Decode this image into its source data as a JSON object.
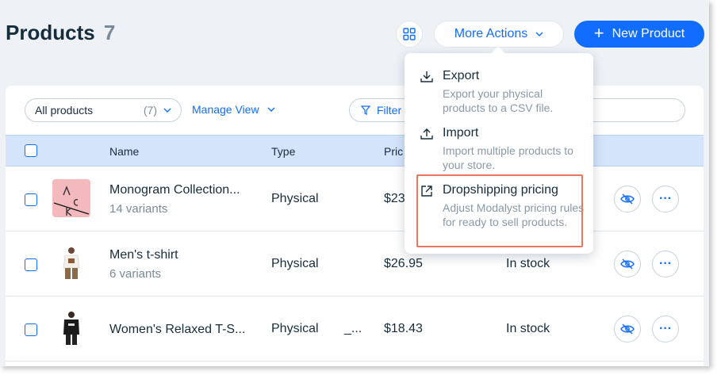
{
  "header": {
    "title": "Products",
    "count": "7",
    "grid_icon": "grid-icon",
    "more_actions_label": "More Actions",
    "new_product_label": "New Product"
  },
  "filters": {
    "select_value": "All products",
    "select_count": "(7)",
    "manage_view_label": "Manage View",
    "filter_label": "Filter"
  },
  "table": {
    "columns": [
      "Name",
      "Type",
      "Pric"
    ],
    "rows": [
      {
        "name": "Monogram Collection...",
        "variants": "14 variants",
        "type": "Physical",
        "price": "$23",
        "inventory": ""
      },
      {
        "name": "Men's t-shirt",
        "variants": "6 variants",
        "type": "Physical",
        "price": "$26.95",
        "inventory": "In stock"
      },
      {
        "name": "Women's Relaxed T-S...",
        "variants": "",
        "type": "Physical",
        "extra": "_...",
        "price": "$18.43",
        "inventory": "In stock"
      }
    ]
  },
  "menu": {
    "items": [
      {
        "title": "Export",
        "desc": "Export your physical products to a CSV file.",
        "icon": "download-icon"
      },
      {
        "title": "Import",
        "desc": "Import multiple products to your store.",
        "icon": "upload-icon"
      },
      {
        "title": "Dropshipping pricing",
        "desc": "Adjust Modalyst pricing rules for ready to sell products.",
        "icon": "external-link-icon"
      }
    ]
  },
  "colors": {
    "accent": "#116dff",
    "header_row": "#d4e5fb",
    "highlight": "#e8775f"
  }
}
